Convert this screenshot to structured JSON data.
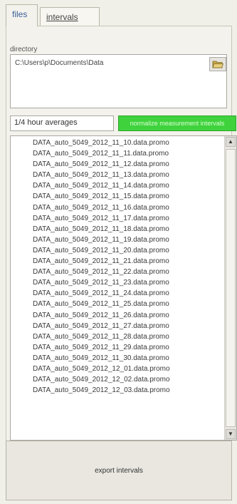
{
  "tabs": [
    {
      "label": "files",
      "active": true
    },
    {
      "label": "intervals",
      "active": false
    }
  ],
  "directory": {
    "label": "directory",
    "path": "C:\\Users\\p\\Documents\\Data"
  },
  "average": {
    "field_value": "1/4 hour averages",
    "button_label": "normalize measurement intervals"
  },
  "files": [
    "DATA_auto_5049_2012_11_10.data.promo",
    "DATA_auto_5049_2012_11_11.data.promo",
    "DATA_auto_5049_2012_11_12.data.promo",
    "DATA_auto_5049_2012_11_13.data.promo",
    "DATA_auto_5049_2012_11_14.data.promo",
    "DATA_auto_5049_2012_11_15.data.promo",
    "DATA_auto_5049_2012_11_16.data.promo",
    "DATA_auto_5049_2012_11_17.data.promo",
    "DATA_auto_5049_2012_11_18.data.promo",
    "DATA_auto_5049_2012_11_19.data.promo",
    "DATA_auto_5049_2012_11_20.data.promo",
    "DATA_auto_5049_2012_11_21.data.promo",
    "DATA_auto_5049_2012_11_22.data.promo",
    "DATA_auto_5049_2012_11_23.data.promo",
    "DATA_auto_5049_2012_11_24.data.promo",
    "DATA_auto_5049_2012_11_25.data.promo",
    "DATA_auto_5049_2012_11_26.data.promo",
    "DATA_auto_5049_2012_11_27.data.promo",
    "DATA_auto_5049_2012_11_28.data.promo",
    "DATA_auto_5049_2012_11_29.data.promo",
    "DATA_auto_5049_2012_11_30.data.promo",
    "DATA_auto_5049_2012_12_01.data.promo",
    "DATA_auto_5049_2012_12_02.data.promo",
    "DATA_auto_5049_2012_12_03.data.promo"
  ],
  "export_button": {
    "label": "export intervals"
  },
  "colors": {
    "accent_green": "#3fd23c",
    "tab_text": "#3b5f9a"
  },
  "icons": {
    "folder": "open-folder-icon"
  }
}
